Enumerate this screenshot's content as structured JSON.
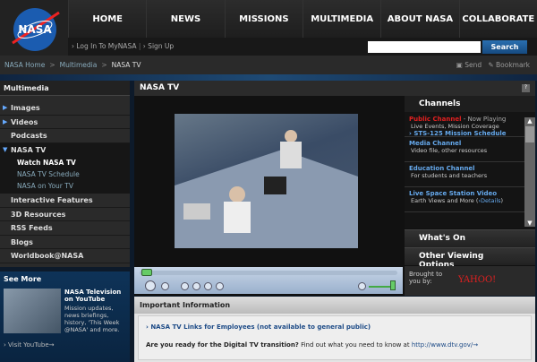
{
  "header": {
    "logo_text": "NASA",
    "nav": [
      "HOME",
      "NEWS",
      "MISSIONS",
      "MULTIMEDIA",
      "ABOUT NASA",
      "COLLABORATE"
    ],
    "login": "› Log In To MyNASA",
    "signup": "› Sign Up",
    "search_value": "",
    "search_button": "Search"
  },
  "breadcrumb": {
    "items": [
      "NASA Home",
      "Multimedia",
      "NASA TV"
    ],
    "send": "Send",
    "bookmark": "Bookmark"
  },
  "sidebar": {
    "title": "Multimedia",
    "items": [
      "Images",
      "Videos",
      "Podcasts",
      "NASA TV"
    ],
    "subitems": [
      "Watch NASA TV",
      "NASA TV Schedule",
      "NASA on Your TV"
    ],
    "items2": [
      "Interactive Features",
      "3D Resources",
      "RSS Feeds",
      "Blogs",
      "Worldbook@NASA"
    ]
  },
  "see_more": {
    "title": "See More",
    "item_title": "NASA Television on YouTube",
    "item_desc": "Mission updates, news briefings, history, 'This Week @NASA' and more.",
    "link": "› Visit YouTube→"
  },
  "main": {
    "title": "NASA TV",
    "help": "?"
  },
  "channels": {
    "title": "Channels",
    "items": [
      {
        "name": "Public Channel",
        "status": " - Now Playing",
        "desc": "Live Events, Mission Coverage",
        "link": "› STS-125 Mission Schedule"
      },
      {
        "name": "Media Channel",
        "desc": "Video file, other resources"
      },
      {
        "name": "Education Channel",
        "desc": "For students and teachers"
      },
      {
        "name": "Live Space Station Video",
        "desc": "Earth Views and More (",
        "link": "›Details",
        "close": ")"
      }
    ]
  },
  "panels": {
    "whats_on": "What's On",
    "other": "Other Viewing Options"
  },
  "sponsor": {
    "label": "Brought to you by:",
    "brand": "YAHOO!"
  },
  "colors": {
    "accent": "#1c5a96",
    "red": "#e02020"
  },
  "info": {
    "title": "Important Information",
    "link": "› NASA TV Links for Employees (not available to general public)",
    "q": "Are you ready for the Digital TV transition?",
    "text": " Find out what you need to know at ",
    "url": "http://www.dtv.gov/→"
  }
}
